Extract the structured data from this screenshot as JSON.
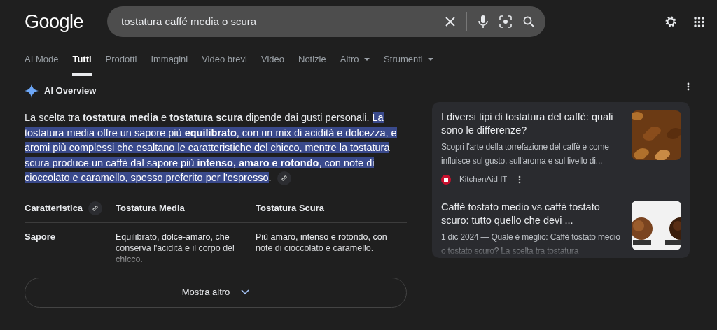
{
  "logo": "Google",
  "search": {
    "value": "tostatura caffé media o scura"
  },
  "tabs": [
    {
      "label": "AI Mode",
      "selected": false,
      "dropdown": false
    },
    {
      "label": "Tutti",
      "selected": true,
      "dropdown": false
    },
    {
      "label": "Prodotti",
      "selected": false,
      "dropdown": false
    },
    {
      "label": "Immagini",
      "selected": false,
      "dropdown": false
    },
    {
      "label": "Video brevi",
      "selected": false,
      "dropdown": false
    },
    {
      "label": "Video",
      "selected": false,
      "dropdown": false
    },
    {
      "label": "Notizie",
      "selected": false,
      "dropdown": false
    },
    {
      "label": "Altro",
      "selected": false,
      "dropdown": true
    },
    {
      "label": "Strumenti",
      "selected": false,
      "dropdown": true
    }
  ],
  "overview": {
    "title": "AI Overview",
    "paragraph": [
      {
        "text": "La scelta tra **tostatura media** e **tostatura scura** dipende dai gusti personali. ",
        "highlighted": false
      },
      {
        "text": "La tostatura media offre un sapore più **equilibrato**, con un mix di acidità e dolcezza, e aromi più complessi che esaltano le caratteristiche del chicco, mentre la tostatura scura produce un caffè dal sapore più **intenso, amaro e rotondo**, con note di cioccolato e caramello, spesso preferito per l'espresso",
        "highlighted": true
      },
      {
        "text": ".",
        "highlighted": false
      }
    ],
    "table": {
      "columns": [
        "Caratteristica",
        "Tostatura Media",
        "Tostatura Scura"
      ],
      "rows": [
        [
          "Sapore",
          "Equilibrato, dolce-amaro, che conserva l'acidità e il corpo del chicco.",
          "Più amaro, intenso e rotondo, con note di cioccolato e caramello."
        ]
      ]
    },
    "more_button": "Mostra altro",
    "sources": [
      {
        "title": "I diversi tipi di tostatura del caffè: quali sono le differenze?",
        "snippet": "Scopri l'arte della torrefazione del caffè e come influisce sul gusto, sull'aroma e sul livello di...",
        "site": "KitchenAid IT",
        "kind": "beans"
      },
      {
        "title": "Caffè tostato medio vs caffè tostato scuro: tutto quello che devi ...",
        "snippet": "1 dic 2024 — Quale è meglio: Caffè tostato medio o tostato scuro? La scelta tra tostatura",
        "kind": "piles"
      }
    ]
  }
}
